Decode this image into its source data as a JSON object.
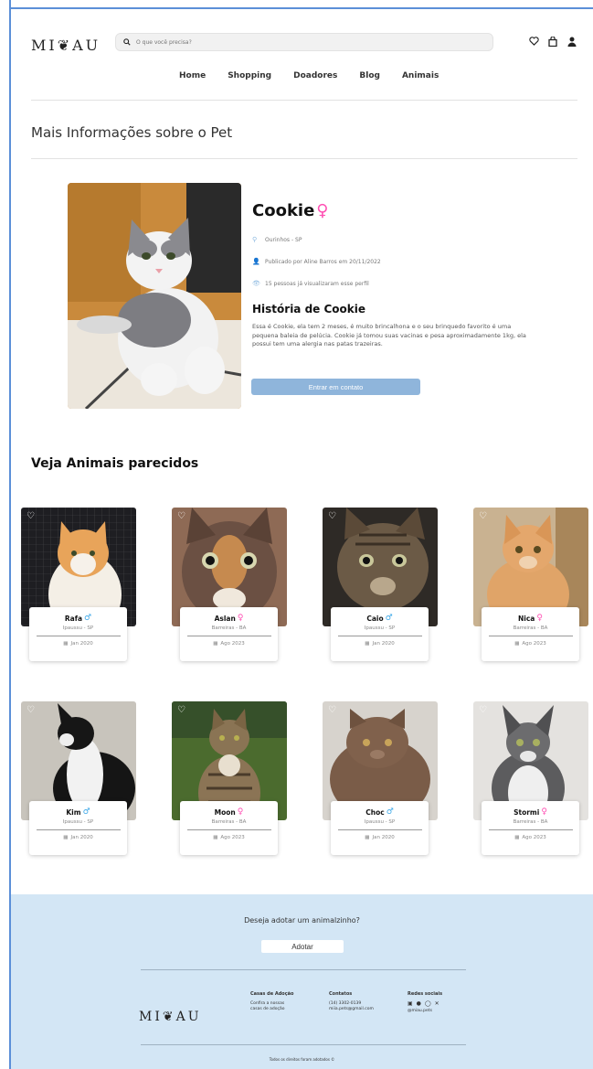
{
  "brand": {
    "logo": "MI❦AU"
  },
  "search": {
    "placeholder": "O que você precisa?"
  },
  "nav": [
    "Home",
    "Shopping",
    "Doadores",
    "Blog",
    "Animais"
  ],
  "page_title": "Mais Informações sobre o Pet",
  "pet": {
    "name": "Cookie",
    "gender_symbol": "♀",
    "location": "Ourinhos - SP",
    "published": "Publicado por Aline Barros em 20/11/2022",
    "views": "15 pessoas já visualizaram esse perfil",
    "story_title": "História de Cookie",
    "story": "Essa é Cookie, ela tem 2 meses, é muito brincalhona e o seu brinquedo favorito é uma pequena baleia de pelúcia. Cookie já tomou suas vacinas e pesa aproximadamente 1kg, ela possui tem uma alergia nas patas trazeiras.",
    "contact_button": "Entrar em contato"
  },
  "similar_title": "Veja Animais parecidos",
  "animals": [
    {
      "name": "Rafa",
      "gender": "♂",
      "location": "Ipaussu - SP",
      "date": "Jan 2020"
    },
    {
      "name": "Aslan",
      "gender": "♀",
      "location": "Barreiras - BA",
      "date": "Ago 2023"
    },
    {
      "name": "Caio",
      "gender": "♂",
      "location": "Ipaussu - SP",
      "date": "Jan 2020"
    },
    {
      "name": "Nica",
      "gender": "♀",
      "location": "Barreiras - BA",
      "date": "Ago 2023"
    },
    {
      "name": "Kim",
      "gender": "♂",
      "location": "Ipaussu - SP",
      "date": "Jan 2020"
    },
    {
      "name": "Moon",
      "gender": "♀",
      "location": "Barreiras - BA",
      "date": "Ago 2023"
    },
    {
      "name": "Choc",
      "gender": "♂",
      "location": "Ipaussu - SP",
      "date": "Jan 2020"
    },
    {
      "name": "Stormi",
      "gender": "♀",
      "location": "Barreiras - BA",
      "date": "Ago 2023"
    }
  ],
  "footer": {
    "question": "Deseja adotar um animalzinho?",
    "adopt_button": "Adotar",
    "logo": "MI❦AU",
    "col1_title": "Casas de Adoção",
    "col1_text": "Confira a nossas casas de adoção",
    "col2_title": "Contatos",
    "col2_phone": "(14) 3302-0139",
    "col2_email": "miia.pets@gmail.com",
    "col3_title": "Redes sociais",
    "col3_handle": "@miau.pets",
    "copyright": "Todos os direitos foram adotados ©"
  },
  "colors": {
    "accent_blue": "#8fb5db",
    "footer_bg": "#d3e6f5",
    "female": "#ff4fb3",
    "male": "#3aa7e8"
  }
}
